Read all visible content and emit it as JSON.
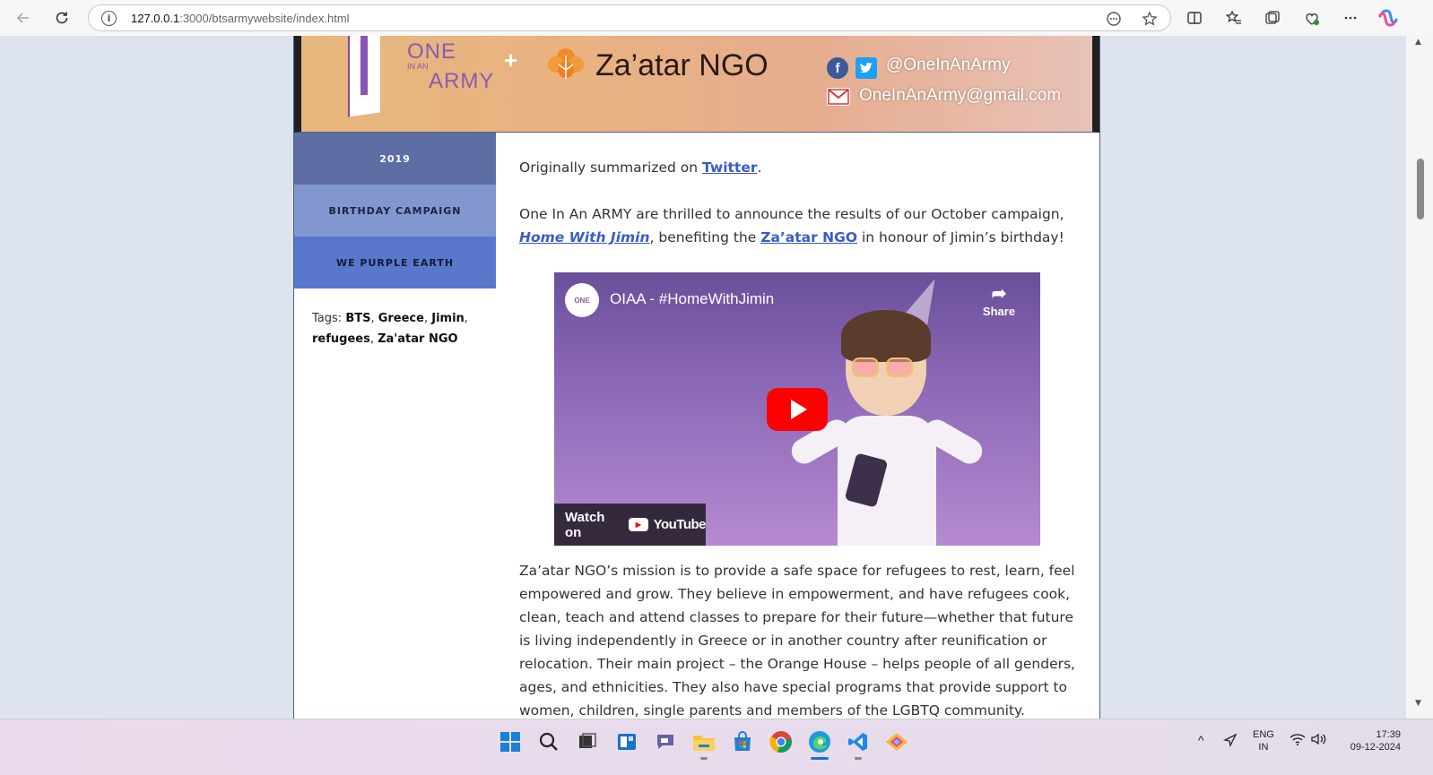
{
  "browser": {
    "url_host": "127.0.0.1",
    "url_rest": ":3000/btsarmywebsite/index.html"
  },
  "banner": {
    "logo_one": "ONE",
    "logo_in_an": "IN AN",
    "logo_army": "ARMY",
    "plus": "+",
    "ngo_name": "Za’atar NGO",
    "social_handle": "@OneInAnArmy",
    "email": "OneInAnArmy@gmail.com"
  },
  "sidebar": {
    "items": [
      {
        "label": "2019"
      },
      {
        "label": "BIRTHDAY CAMPAIGN"
      },
      {
        "label": "WE PURPLE EARTH"
      }
    ],
    "tags_label": "Tags:",
    "tags": [
      "BTS",
      "Greece",
      "Jimin",
      "refugees",
      "Za'atar NGO"
    ]
  },
  "content": {
    "intro_prefix": "Originally summarized on ",
    "intro_link": "Twitter",
    "intro_suffix": ".",
    "announce_1": "One In An ARMY are thrilled to announce the results of our October campaign, ",
    "announce_link1": "Home With Jimin",
    "announce_2": ", benefiting the ",
    "announce_link2": "Za’atar NGO",
    "announce_3": " in honour of Jimin’s birthday!",
    "mission": "Za’atar NGO’s mission is to provide a safe space for refugees to rest, learn, feel empowered and grow. They believe in empowerment, and have refugees cook, clean, teach and attend classes to prepare for their future—whether that future is living independently in Greece or in another country after reunification or relocation. Their main project – the Orange House – helps people of all genders, ages, and ethnicities. They also have special programs that provide support to women, children, single parents and members of the LGBTQ community."
  },
  "video": {
    "title": "OIAA - #HomeWithJimin",
    "share_label": "Share",
    "watch_on": "Watch on",
    "youtube": "YouTube",
    "channel_badge": "ONE"
  },
  "taskbar": {
    "lang_1": "ENG",
    "lang_2": "IN",
    "time": "17:39",
    "date": "09-12-2024"
  },
  "colors": {
    "nav_2019": "#5e6ea5",
    "nav_birthday": "#8297cf",
    "nav_purple": "#5a78cb",
    "link": "#3a5cc6"
  }
}
